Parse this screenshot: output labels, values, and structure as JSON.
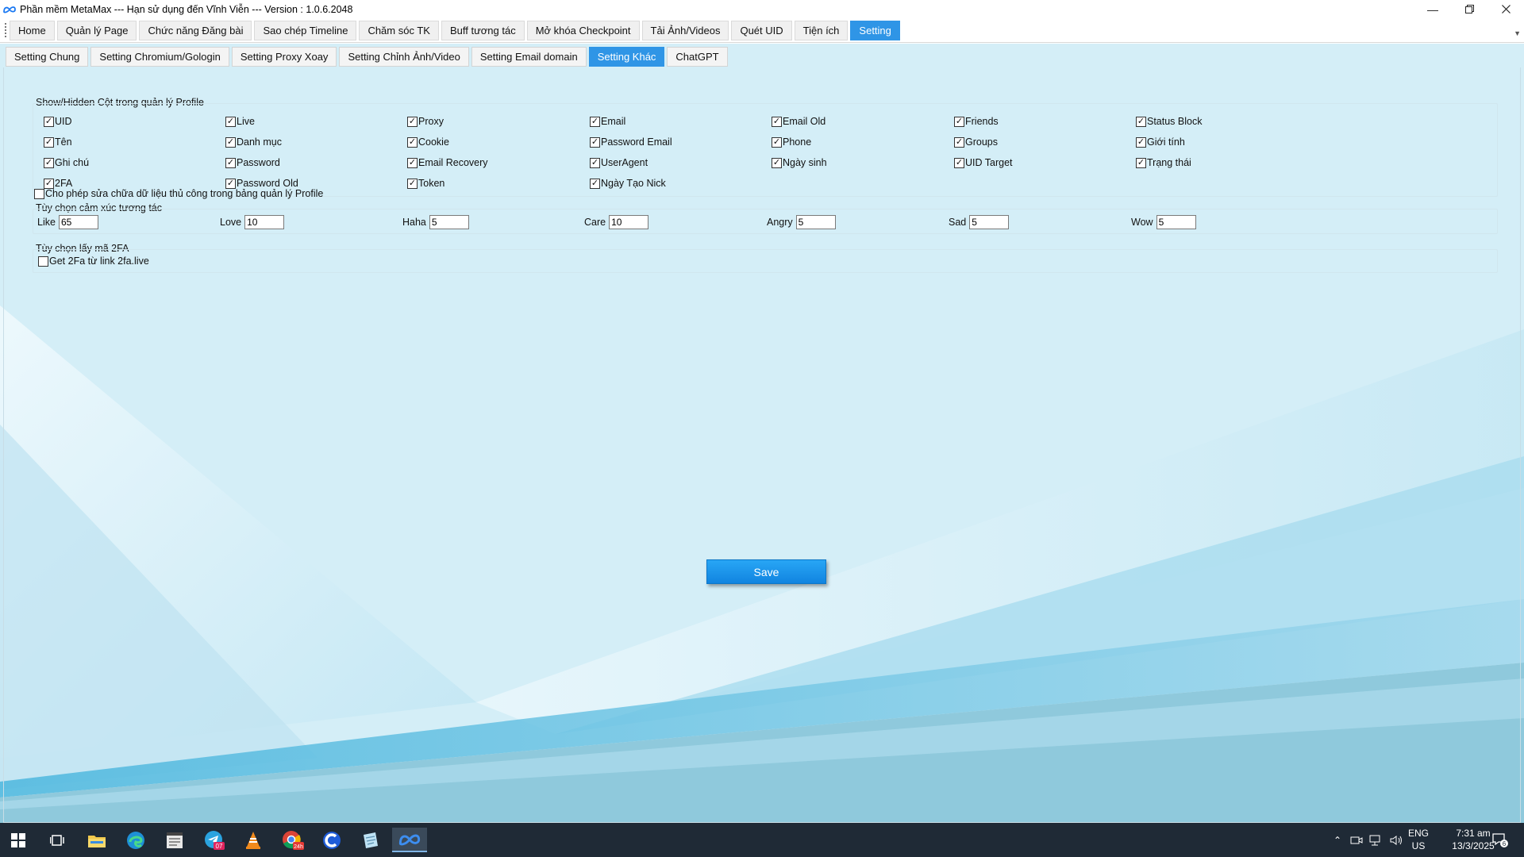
{
  "window": {
    "title": "Phần mềm MetaMax --- Hạn sử dụng đến Vĩnh Viễn --- Version : 1.0.6.2048",
    "controls": [
      "minimize",
      "restore",
      "close"
    ]
  },
  "main_menu": [
    {
      "label": "Home"
    },
    {
      "label": "Quản lý Page"
    },
    {
      "label": "Chức năng Đăng bài"
    },
    {
      "label": "Sao chép Timeline"
    },
    {
      "label": "Chăm sóc TK"
    },
    {
      "label": "Buff tương tác"
    },
    {
      "label": "Mở khóa Checkpoint"
    },
    {
      "label": "Tải Ảnh/Videos"
    },
    {
      "label": "Quét UID"
    },
    {
      "label": "Tiện ích"
    },
    {
      "label": "Setting",
      "active": true
    }
  ],
  "sub_tabs": [
    {
      "label": "Setting Chung"
    },
    {
      "label": "Setting Chromium/Gologin"
    },
    {
      "label": "Setting Proxy Xoay"
    },
    {
      "label": "Setting Chỉnh Ảnh/Video"
    },
    {
      "label": "Setting Email domain"
    },
    {
      "label": "Setting Khác",
      "active": true
    },
    {
      "label": "ChatGPT"
    }
  ],
  "columns_group": {
    "title": "Show/Hidden Cột trong quản lý Profile",
    "items": [
      {
        "label": "UID",
        "checked": true
      },
      {
        "label": "Live",
        "checked": true
      },
      {
        "label": "Proxy",
        "checked": true
      },
      {
        "label": "Email",
        "checked": true
      },
      {
        "label": "Email Old",
        "checked": true
      },
      {
        "label": "Friends",
        "checked": true
      },
      {
        "label": "Status Block",
        "checked": true
      },
      {
        "label": "Tên",
        "checked": true
      },
      {
        "label": "Danh mục",
        "checked": true
      },
      {
        "label": "Cookie",
        "checked": true
      },
      {
        "label": "Password Email",
        "checked": true
      },
      {
        "label": "Phone",
        "checked": true
      },
      {
        "label": "Groups",
        "checked": true
      },
      {
        "label": "Giới tính",
        "checked": true
      },
      {
        "label": "Ghi chú",
        "checked": true
      },
      {
        "label": "Password",
        "checked": true
      },
      {
        "label": "Email Recovery",
        "checked": true
      },
      {
        "label": "UserAgent",
        "checked": true
      },
      {
        "label": "Ngày sinh",
        "checked": true
      },
      {
        "label": "UID Target",
        "checked": true
      },
      {
        "label": "Trạng thái",
        "checked": true
      },
      {
        "label": "2FA",
        "checked": true
      },
      {
        "label": "Password Old",
        "checked": true
      },
      {
        "label": "Token",
        "checked": true
      },
      {
        "label": "Ngày Tạo Nick",
        "checked": true
      }
    ]
  },
  "manual_edit": {
    "label": "Cho phép sửa chữa dữ liệu thủ công trong bảng quản lý Profile",
    "checked": false
  },
  "reactions_group": {
    "title": "Tùy chọn cảm xúc tương tác",
    "items": [
      {
        "label": "Like",
        "value": "65"
      },
      {
        "label": "Love",
        "value": "10"
      },
      {
        "label": "Haha",
        "value": "5"
      },
      {
        "label": "Care",
        "value": "10"
      },
      {
        "label": "Angry",
        "value": "5"
      },
      {
        "label": "Sad",
        "value": "5"
      },
      {
        "label": "Wow",
        "value": "5"
      }
    ]
  },
  "twofa_group": {
    "title": "Tùy chọn lấy mã 2FA",
    "option": {
      "label": "Get 2Fa từ link 2fa.live",
      "checked": false
    }
  },
  "save_label": "Save",
  "taskbar": {
    "apps": [
      "windows-start",
      "task-view",
      "file-explorer",
      "edge",
      "notepad",
      "telegram",
      "vlc",
      "chrome",
      "coccoc",
      "notes",
      "metamax"
    ],
    "telegram_badge": "07",
    "chrome_badge": "24h",
    "lang": "ENG",
    "region": "US",
    "time": "7:31 am",
    "date": "13/3/2025",
    "notifications": "6"
  },
  "colors": {
    "accent": "#2f95e6",
    "content_bg": "#d3eef7",
    "taskbar": "#1f2a36"
  }
}
